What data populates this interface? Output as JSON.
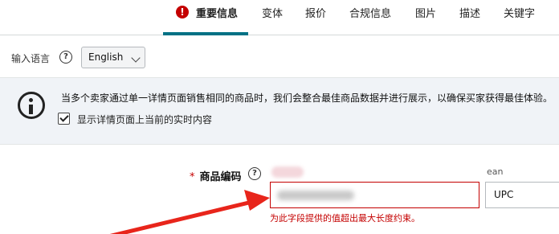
{
  "tabs": [
    {
      "label": "重要信息",
      "active": true,
      "alert": "!"
    },
    {
      "label": "变体"
    },
    {
      "label": "报价"
    },
    {
      "label": "合规信息"
    },
    {
      "label": "图片"
    },
    {
      "label": "描述"
    },
    {
      "label": "关键字"
    }
  ],
  "language": {
    "label": "输入语言",
    "help": "?",
    "selected": "English"
  },
  "info": {
    "text": "当多个卖家通过单一详情页面销售相同的商品时，我们会整合最佳商品数据并进行展示，以确保买家获得最佳体验。",
    "checkbox_label": "显示详情页面上当前的实时内容",
    "checkbox_checked": true
  },
  "product_id": {
    "required_mark": "*",
    "label": "商品编码",
    "help": "?",
    "type_hint": "ean",
    "type_value": "UPC",
    "error": "为此字段提供的值超出最大长度约束。"
  },
  "colors": {
    "accent": "#007185",
    "error": "#c40000",
    "annotation_arrow": "#e8251b"
  }
}
